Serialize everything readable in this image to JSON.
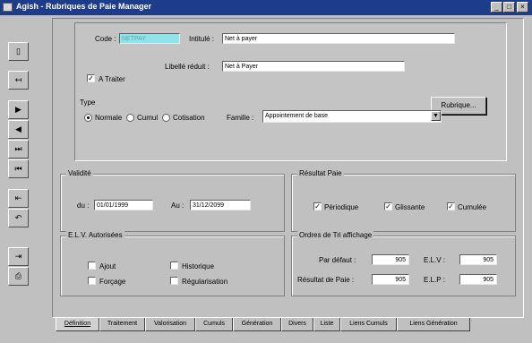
{
  "window": {
    "title": "Agish - Rubriques de Paie Manager",
    "controls": {
      "minimize": "_",
      "maximize": "□",
      "close": "×"
    }
  },
  "toolbar": {
    "items": [
      {
        "icon": "new-document-icon",
        "glyph": "▯"
      },
      {
        "icon": "back-to-start-icon",
        "glyph": "↤"
      },
      {
        "icon": "next-record-icon",
        "glyph": "▶"
      },
      {
        "icon": "previous-record-icon",
        "glyph": "◀"
      },
      {
        "icon": "last-record-icon",
        "glyph": "⏭"
      },
      {
        "icon": "first-record-icon",
        "glyph": "⏮"
      },
      {
        "icon": "import-icon",
        "glyph": "⇤"
      },
      {
        "icon": "undo-icon",
        "glyph": "↶"
      },
      {
        "icon": "exit-icon",
        "glyph": "⇥"
      },
      {
        "icon": "print-icon",
        "glyph": "⎙"
      }
    ]
  },
  "header": {
    "code_label": "Code :",
    "code_value": "NETPAY",
    "intitule_label": "Intitulé :",
    "intitule_value": "Net à payer",
    "libelle_label": "Libellé réduit :",
    "libelle_value": "Net à Payer",
    "a_traiter_label": "A Traiter",
    "a_traiter_checked": "✓",
    "type_label": "Type",
    "type_options": [
      "Normale",
      "Cumul",
      "Cotisation"
    ],
    "type_selected": "Normale",
    "famille_label": "Famille :",
    "famille_value": "Appointement de base",
    "rubrique_button": "Rubrique..."
  },
  "validite": {
    "title": "Validité",
    "du_label": "du :",
    "du_value": "01/01/1999",
    "au_label": "Au :",
    "au_value": "31/12/2099"
  },
  "resultat": {
    "title": "Résultat Paie",
    "periodique_label": "Périodique",
    "glissante_label": "Glissante",
    "cumulee_label": "Cumulée",
    "check": "✓"
  },
  "elv": {
    "title": "E.L.V. Autorisées",
    "ajout_label": "Ajout",
    "forcage_label": "Forçage",
    "historique_label": "Historique",
    "regularisation_label": "Régularisation"
  },
  "ordre": {
    "title": "Ordres de Tri affichage",
    "par_defaut_label": "Par défaut :",
    "par_defaut_value": "905",
    "resultat_label": "Résultat de Paie :",
    "resultat_value": "905",
    "elv_label": "E.L.V :",
    "elv_value": "905",
    "elp_label": "E.L.P :",
    "elp_value": "905"
  },
  "tabs": [
    "Définition",
    "Traitement",
    "Valorisation",
    "Cumuls",
    "Génération",
    "Divers",
    "Liste",
    "Liens Cumuls",
    "Liens Génération"
  ]
}
